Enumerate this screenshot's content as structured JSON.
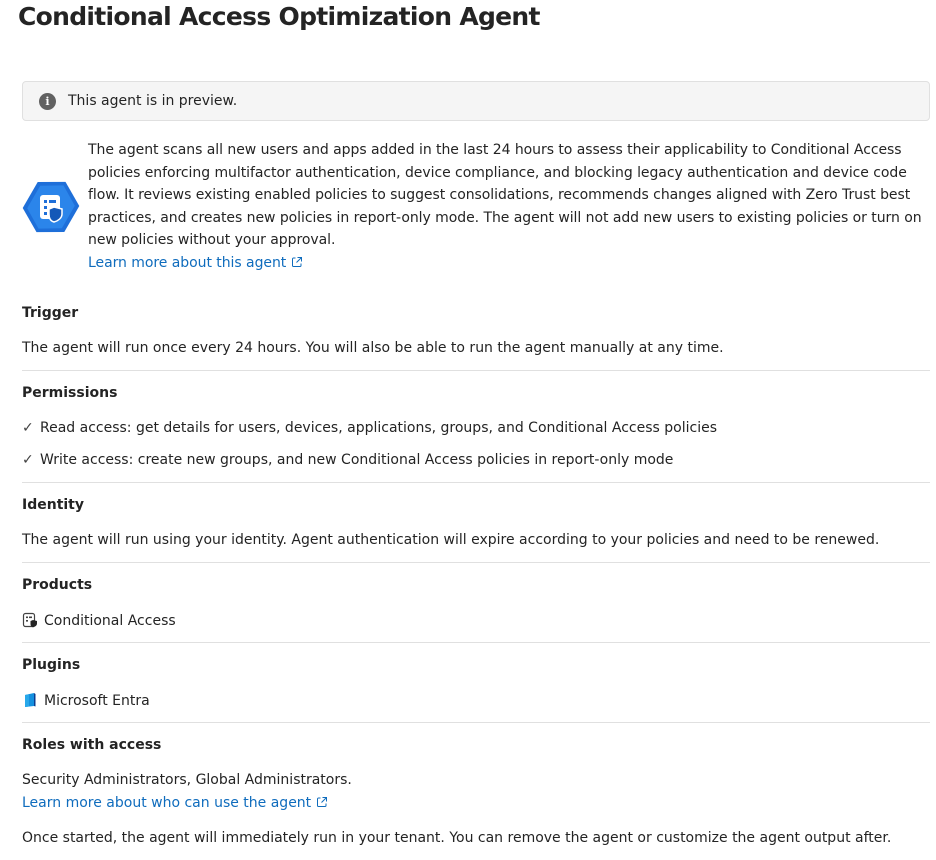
{
  "title": "Conditional Access Optimization Agent",
  "banner": {
    "icon": "info-icon",
    "text": "This agent is in preview."
  },
  "description": {
    "lines": [
      "The agent scans all new users and apps added in the last 24 hours to assess their applicability to Conditional Access",
      "policies enforcing multifactor authentication, device compliance, and blocking legacy authentication and device code",
      "flow. It reviews existing enabled policies to suggest consolidations, recommends changes aligned with Zero Trust best",
      "practices, and creates new policies in report-only mode. The agent will not add new users to existing policies or turn on",
      "new policies without your approval."
    ],
    "link": "Learn more about this agent"
  },
  "trigger": {
    "title": "Trigger",
    "text": "The agent will run once every 24 hours. You will also be able to run the agent manually at any time."
  },
  "permissions": {
    "title": "Permissions",
    "items": [
      "Read access: get details for users, devices, applications, groups, and Conditional Access policies",
      "Write access: create new groups, and new Conditional Access policies in report-only mode"
    ]
  },
  "identity": {
    "title": "Identity",
    "text": "The agent will run using your identity. Agent authentication will expire according to your policies and need to be renewed."
  },
  "products": {
    "title": "Products",
    "item": "Conditional Access",
    "icon": "conditional-access-icon"
  },
  "plugins": {
    "title": "Plugins",
    "item": "Microsoft Entra",
    "icon": "microsoft-entra-icon"
  },
  "roles": {
    "title": "Roles with access",
    "text": "Security Administrators, Global Administrators.",
    "link": "Learn more about who can use the agent"
  },
  "footer": "Once started, the agent will immediately run in your tenant. You can remove the agent or customize the agent output after.",
  "colors": {
    "link": "#0f6cbd",
    "agent_icon": "#1e6fd9",
    "divider": "#e0e0e0"
  }
}
